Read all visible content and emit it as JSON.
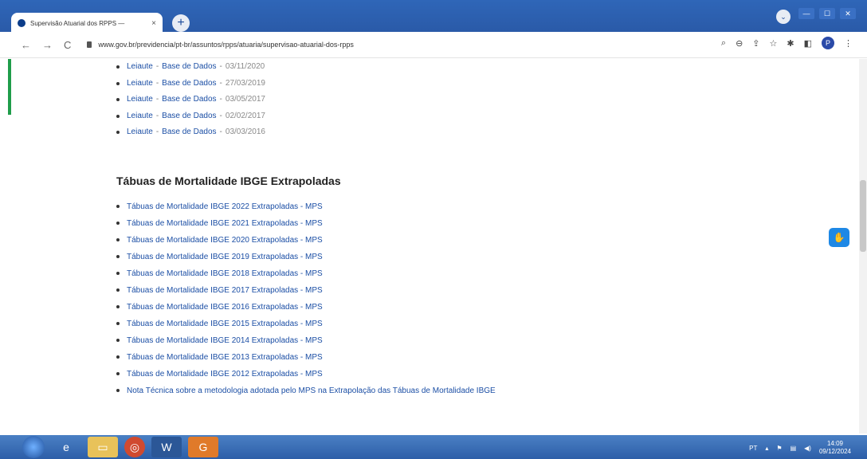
{
  "browser": {
    "tab_title": "Supervisão Atuarial dos RPPS —",
    "tab_close": "×",
    "new_tab": "+",
    "url": "www.gov.br/previdencia/pt-br/assuntos/rpps/atuaria/supervisao-atuarial-dos-rpps",
    "nav": {
      "back": "←",
      "forward": "→",
      "reload": "C"
    },
    "profile_initial": "P",
    "window_controls": {
      "dropdown": "⌄",
      "minimize": "—",
      "maximize": "☐",
      "close": "✕"
    }
  },
  "leiaute_items": [
    {
      "label": "Leiaute",
      "base": "Base de Dados",
      "date": "03/11/2020"
    },
    {
      "label": "Leiaute",
      "base": "Base de Dados",
      "date": "27/03/2019"
    },
    {
      "label": "Leiaute",
      "base": "Base de Dados",
      "date": "03/05/2017"
    },
    {
      "label": "Leiaute",
      "base": "Base de Dados",
      "date": "02/02/2017"
    },
    {
      "label": "Leiaute",
      "base": "Base de Dados",
      "date": "03/03/2016"
    }
  ],
  "section": {
    "title": "Tábuas de Mortalidade IBGE Extrapoladas",
    "items": [
      "Tábuas de Mortalidade IBGE 2022 Extrapoladas - MPS",
      "Tábuas de Mortalidade IBGE 2021 Extrapoladas - MPS",
      "Tábuas de Mortalidade IBGE 2020 Extrapoladas - MPS",
      "Tábuas de Mortalidade IBGE 2019 Extrapoladas - MPS",
      "Tábuas de Mortalidade IBGE 2018 Extrapoladas - MPS",
      "Tábuas de Mortalidade IBGE 2017 Extrapoladas - MPS",
      "Tábuas de Mortalidade IBGE 2016 Extrapoladas - MPS",
      "Tábuas de Mortalidade IBGE 2015 Extrapoladas - MPS",
      "Tábuas de Mortalidade IBGE 2014 Extrapoladas - MPS",
      "Tábuas de Mortalidade IBGE 2013 Extrapoladas - MPS",
      "Tábuas de Mortalidade IBGE 2012 Extrapoladas - MPS",
      "Nota Técnica sobre a metodologia adotada pelo MPS na Extrapolação das Tábuas de Mortalidade IBGE"
    ]
  },
  "taskbar": {
    "language": "PT",
    "time": "14:09",
    "date": "09/12/2024"
  },
  "colors": {
    "link": "#1c4fa5",
    "accent": "#1f9d4a",
    "taskbar": "#2d5ea8"
  }
}
